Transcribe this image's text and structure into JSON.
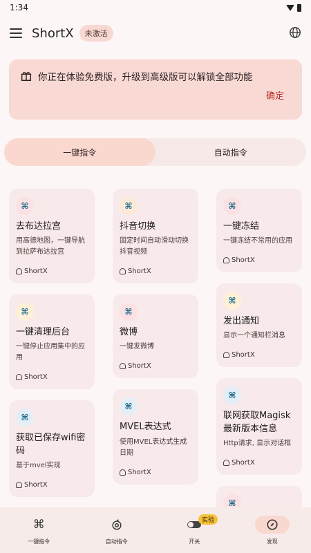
{
  "status": {
    "time": "1:34"
  },
  "appbar": {
    "title": "ShortX",
    "badge": "未激活"
  },
  "notice": {
    "text": "你正在体验免费版，升级到高级版可以解锁全部功能",
    "confirm": "确定"
  },
  "segments": [
    "一键指令",
    "自动指令"
  ],
  "cards": [
    {
      "title": "去布达拉宫",
      "desc": "用高德地图，一键导航到拉萨布达拉宫",
      "author": "ShortX",
      "icon": "command-icon",
      "bg": "#fbe0e4"
    },
    {
      "title": "抖音切换",
      "desc": "固定时间自动滑动切换抖音视频",
      "author": "ShortX",
      "icon": "command-icon",
      "bg": "#fde9d8"
    },
    {
      "title": "一键冻结",
      "desc": "一键冻结不常用的应用",
      "author": "ShortX",
      "icon": "command-icon",
      "bg": "#fbe0e4"
    },
    {
      "title": "一键清理后台",
      "desc": "一键停止应用集中的应用",
      "author": "ShortX",
      "icon": "command-icon",
      "bg": "#fff0d8"
    },
    {
      "title": "微博",
      "desc": "一键发微博",
      "author": "ShortX",
      "icon": "command-icon",
      "bg": "#fbe0e4"
    },
    {
      "title": "发出通知",
      "desc": "显示一个通知栏消息",
      "author": "ShortX",
      "icon": "command-icon",
      "bg": "#fff0d8"
    },
    {
      "title": "获取已保存wifi密码",
      "desc": "基于mvel实现",
      "author": "ShortX",
      "icon": "command-icon",
      "bg": "#e4eef6"
    },
    {
      "title": "MVEL表达式",
      "desc": "使用MVEL表达式生成日期",
      "author": "ShortX",
      "icon": "command-icon",
      "bg": "#e4eef6"
    },
    {
      "title": "联网获取Magisk最新版本信息",
      "desc": "Http请求, 显示对话框",
      "author": "ShortX",
      "icon": "command-icon",
      "bg": "#e4eef6"
    },
    {
      "title": "",
      "desc": "",
      "author": "",
      "icon": "command-icon",
      "bg": "#fbe0e4"
    }
  ],
  "bottomnav": [
    {
      "label": "一键指令",
      "icon": "command-icon"
    },
    {
      "label": "自动指令",
      "icon": "auto-icon"
    },
    {
      "label": "开关",
      "icon": "toggle-icon",
      "badge": "实验"
    },
    {
      "label": "发现",
      "icon": "compass-icon"
    }
  ]
}
